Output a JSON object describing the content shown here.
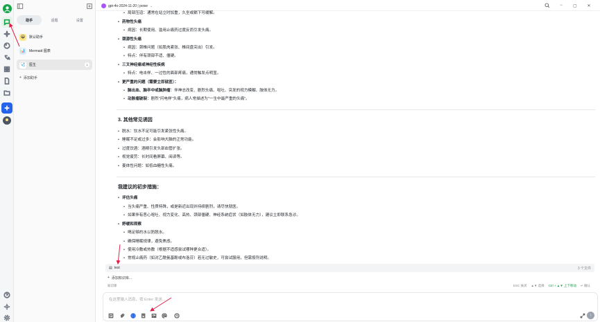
{
  "rail": {
    "icons": [
      "user-avatar-icon",
      "chat-icon",
      "sparkle-icon",
      "palette-icon",
      "translate-icon",
      "grid-icon",
      "document-icon",
      "folder-icon",
      "app-icon",
      "user-avatar-icon"
    ],
    "bottom_icons": [
      "help-icon",
      "sun-icon",
      "gear-icon"
    ]
  },
  "panel": {
    "tabs": [
      {
        "label": "助手"
      },
      {
        "label": "话题"
      },
      {
        "label": "设置"
      }
    ],
    "assistants": [
      {
        "label": "默认助手",
        "emoji": "😀"
      },
      {
        "label": "Mermaid 图表",
        "emoji": "📊"
      },
      {
        "label": "医生",
        "emoji": "🩺",
        "count": "1"
      }
    ],
    "add_label": "添加助手"
  },
  "topbar": {
    "model": "gpt-4o-2024-11-20 | poixe"
  },
  "content": {
    "l0": "局部压迫：通常在站立时加重，久坐或躺下可缓解。",
    "l1": "药物性头痛",
    "l2": "病因：长期使用、滥用止痛药过度反而引发头痛。",
    "l3": "颈源性头痛",
    "l4": "病因：颈椎问题（如肌肉紧张、椎间盘突出）引发。",
    "l5": "特点：伴有颈部不适、僵硬。",
    "l6": "三叉神经痛或神经性疾病",
    "l7": "特点：电击样、一过性的面部疼痛，通常触发点明显。",
    "l8": "更严重的问题（需要立即就医）：",
    "l9a": "脑出血、脑卒中或脑肿瘤",
    "l9b": "：伴神志改变、剧烈头痛、呕吐、突发的视力模糊、肢体无力。",
    "l10a": "动脉瘤破裂",
    "l10b": "：剧烈\"闪电样\"头痛，病人常描述为\"一生中最严重的头痛\"。",
    "h_other": "3. 其他常见诱因",
    "o1": "脱水：饮水不足可能引发紧张性头痛。",
    "o2": "睡眠不足或过多：会影响大脑的正常功能。",
    "o3": "过度饮酒：酒精引发头部血管扩张。",
    "o4": "视觉疲劳：长时间看屏幕、阅读等。",
    "o5": "姜体性问题：如低血糖性头痛。",
    "h_advice": "我建议的初步措施：",
    "a1": "评估头痛",
    "a2": "当头痛严重、性质特殊，或是新近出现并持续剧烈，请尽快就医。",
    "a3": "如果伴有恶心呕吐、视力变化、高热、颈部僵硬、神经系统症状（如肢体无力），建议立即联系急诊。",
    "a4": "舒缓和观察",
    "a5": "喝足够的水以防脱水。",
    "a6": "确保睡眠规律，避免焦虑。",
    "a7": "使用冷敷或热敷（根据不适感尝试哪种更合适）。",
    "a8": "常规止痛药（如对乙酰氨基酚或布洛芬）若无过敏史，可尝试服用，但需按剂说明。"
  },
  "input": {
    "kb_item": "test",
    "kb_count": "3 个文件",
    "kb_add": "添加知识库...",
    "kb_hint": "知识库",
    "esc_hint": "ESC 关闭",
    "nav_hint": "▲▼ 选择",
    "ctrl_hint": "Ctrl + ▲▼ 上下移动",
    "enter_hint": "↵ 确认",
    "placeholder": "在这里输入消息，按 Enter 发送..."
  },
  "colors": {
    "accent": "#16a34a",
    "annotation": "#e11d48",
    "model_dot": "#a855f7"
  }
}
